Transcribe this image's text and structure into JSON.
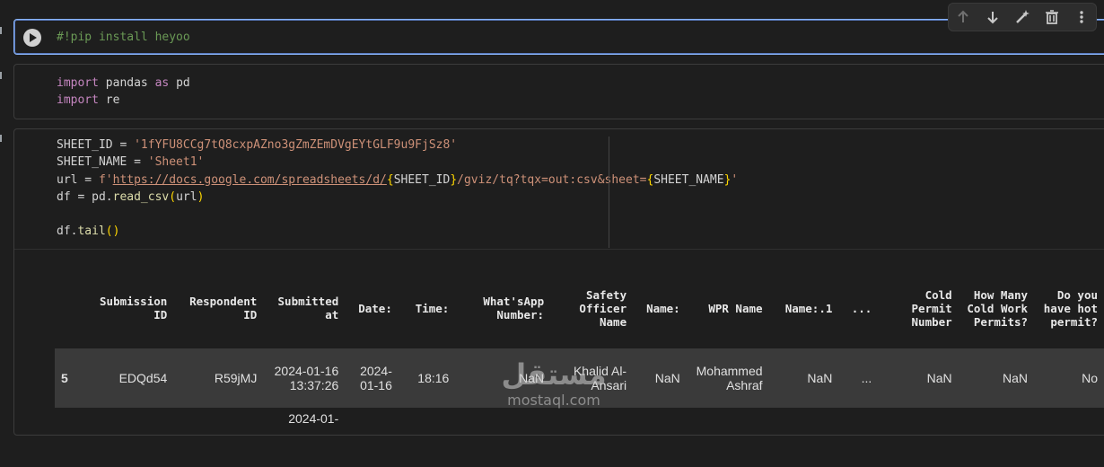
{
  "cell1": {
    "code": "#!pip install heyoo"
  },
  "cell2": {
    "import1_kw": "import",
    "import1_rest": " pandas ",
    "import1_as": "as",
    "import1_alias": " pd",
    "import2_kw": "import",
    "import2_rest": " re"
  },
  "cell3": {
    "line1_lhs": "SHEET_ID = ",
    "line1_str": "'1fYFU8CCg7tQ8cxpAZno3gZmZEmDVgEYtGLF9u9FjSz8'",
    "line2_lhs": "SHEET_NAME = ",
    "line2_str": "'Sheet1'",
    "line3_lhs": "url = ",
    "line3_f": "f'",
    "line3_url": "https://docs.google.com/spreadsheets/d/",
    "line3_b1": "{",
    "line3_v1": "SHEET_ID",
    "line3_b2": "}",
    "line3_mid": "/gviz/tq?tqx=out:csv&sheet=",
    "line3_b3": "{",
    "line3_v2": "SHEET_NAME",
    "line3_b4": "}",
    "line3_end": "'",
    "line4_lhs": "df = pd.",
    "line4_fn": "read_csv",
    "line4_p1": "(",
    "line4_arg": "url",
    "line4_p2": ")",
    "line5_lhs": "df.",
    "line5_fn": "tail",
    "line5_parens": "()"
  },
  "table": {
    "headers": [
      "",
      "Submission ID",
      "Respondent ID",
      "Submitted at",
      "Date:",
      "Time:",
      "What'sApp Number:",
      "Safety Officer Name",
      "Name:",
      "WPR Name",
      "Name:.1",
      "...",
      "Cold Permit Number",
      "How Many Cold Work Permits?",
      "Do you have hot permit?"
    ],
    "rows": [
      [
        "5",
        "EDQd54",
        "R59jMJ",
        "2024-01-16 13:37:26",
        "2024-01-16",
        "18:16",
        "NaN",
        "Khalid Al-Ansari",
        "NaN",
        "Mohammed Ashraf",
        "NaN",
        "...",
        "NaN",
        "NaN",
        "No"
      ],
      [
        "",
        "",
        "",
        "2024-01-",
        "",
        "",
        "",
        "",
        "",
        "",
        "",
        "",
        "",
        "",
        ""
      ]
    ]
  },
  "watermark": {
    "arabic": "مستقل",
    "latin": "mostaql.com"
  },
  "colors": {
    "accent": "#8ab4f8",
    "background": "#1e1e1e",
    "keyword": "#c586c0",
    "string": "#ce9178",
    "comment": "#6a9955"
  }
}
